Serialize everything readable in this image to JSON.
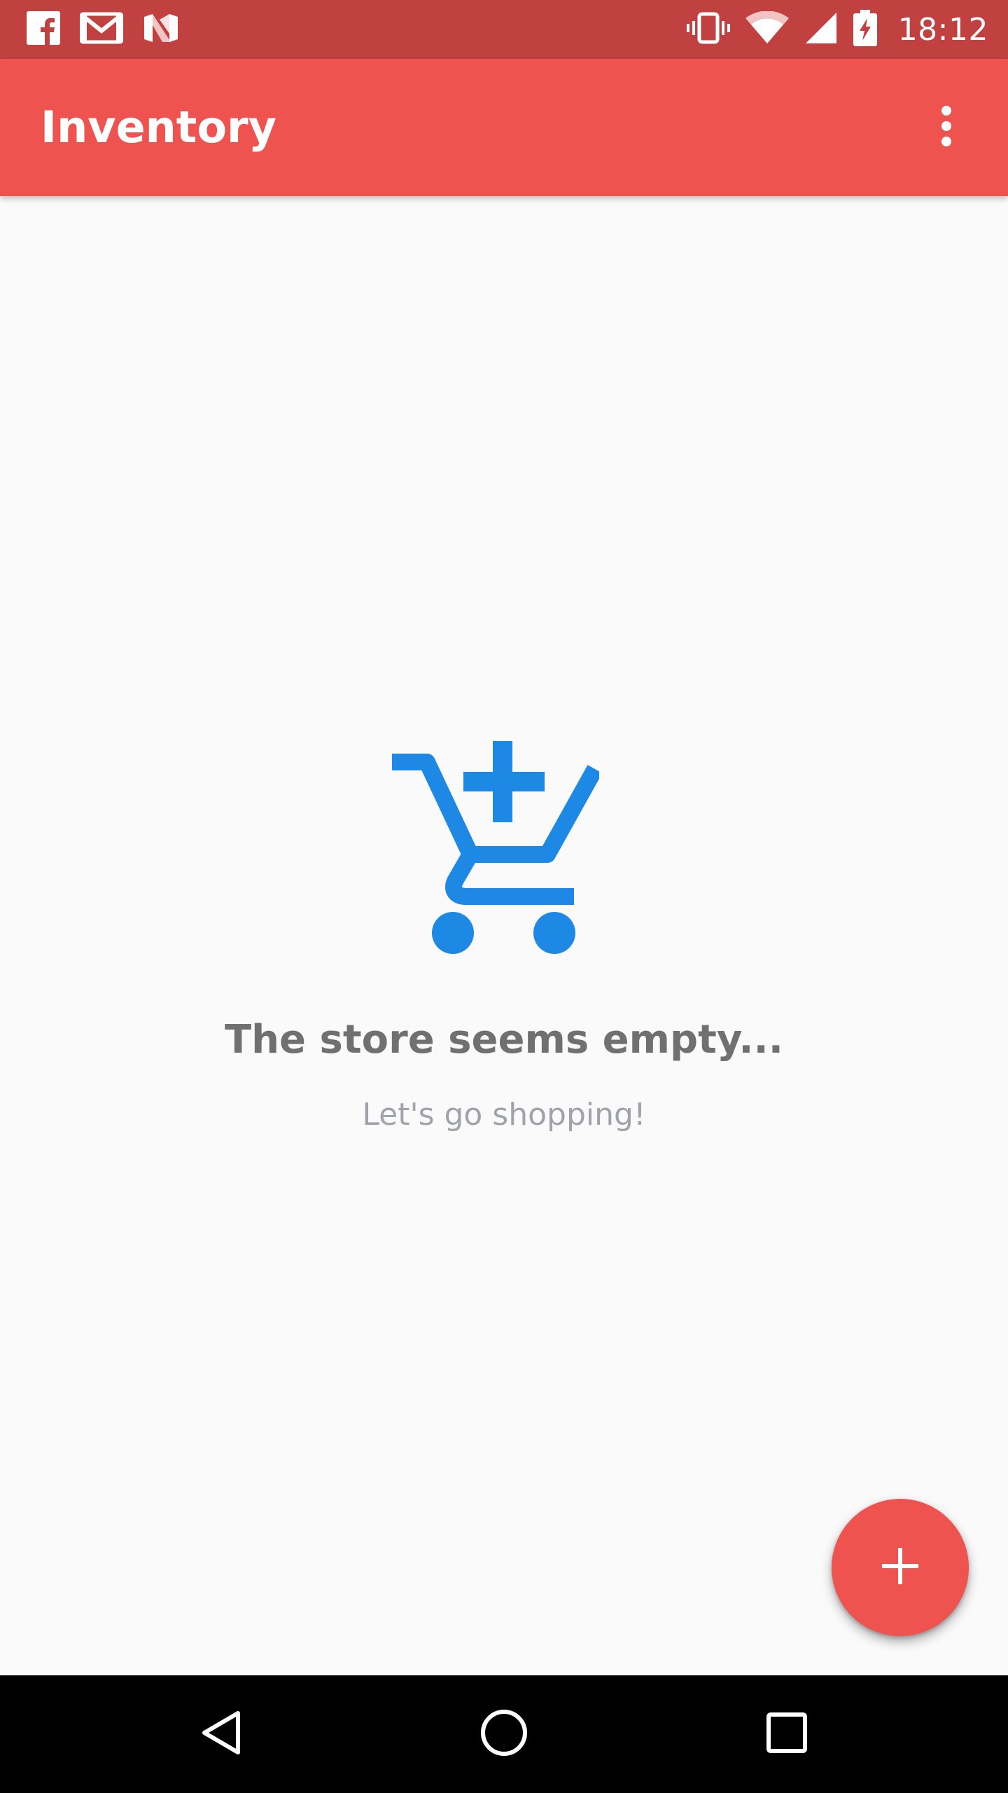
{
  "status_bar": {
    "time": "18:12",
    "left_icons": [
      "facebook-icon",
      "gmail-icon",
      "n-app-icon"
    ],
    "right_icons": [
      "vibrate-icon",
      "wifi-icon",
      "cell-signal-icon",
      "battery-charging-icon"
    ],
    "background_color": "#c0413f"
  },
  "app_bar": {
    "title": "Inventory",
    "overflow_icon": "more-vert-icon",
    "background_color": "#ef5350"
  },
  "empty_state": {
    "icon": "add-shopping-cart-icon",
    "icon_color": "#1e88e5",
    "title": "The store seems empty...",
    "subtitle": "Let's go shopping!"
  },
  "fab": {
    "icon": "plus-icon",
    "background_color": "#ef5350"
  },
  "nav_bar": {
    "buttons": [
      "back-icon",
      "home-icon",
      "recents-icon"
    ]
  }
}
